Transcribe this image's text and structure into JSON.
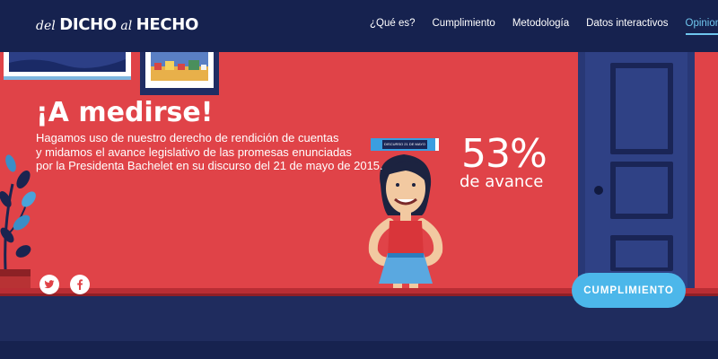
{
  "header": {
    "logo": {
      "part1": "del",
      "part2": "DICHO",
      "part3": "al",
      "part4": "HECHO"
    },
    "nav": [
      {
        "label": "¿Qué es?",
        "active": false
      },
      {
        "label": "Cumplimiento",
        "active": false
      },
      {
        "label": "Metodología",
        "active": false
      },
      {
        "label": "Datos interactivos",
        "active": false
      },
      {
        "label": "Opiniones",
        "active": true
      }
    ]
  },
  "hero": {
    "title": "¡A medirse!",
    "description_lines": [
      "Hagamos uso de nuestro derecho de rendición de cuentas",
      "y midamos el avance legislativo de las promesas enunciadas",
      "por la Presidenta Bachelet en su discurso del 21 de mayo de 2015."
    ],
    "progress_percent": "53%",
    "progress_value": 53,
    "progress_label": "de avance",
    "book_label": "DISCURSO 21 DE MAYO"
  },
  "social": [
    {
      "icon": "twitter-icon"
    },
    {
      "icon": "facebook-icon"
    }
  ],
  "cta": {
    "label": "CUMPLIMIENTO"
  },
  "colors": {
    "header": "#16224f",
    "wall": "#e04348",
    "floor": "#1f2c5e",
    "accent": "#4cb7ea",
    "door": "#293b7c"
  }
}
